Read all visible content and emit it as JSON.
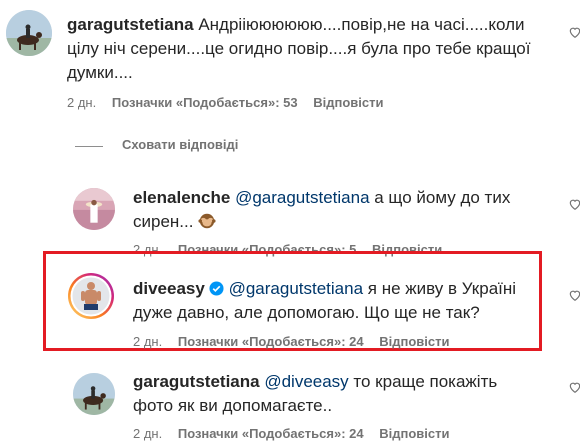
{
  "comments": [
    {
      "username": "garagutstetiana",
      "text": "Андрііюююююю....повір,не на часі.....коли цілу ніч серени....це огидно повір....я була про тебе кращої думки....",
      "time": "2 дн.",
      "likes": "Позначки «Подобається»: 53",
      "reply": "Відповісти",
      "avatar_icon": "horse-rider-avatar"
    },
    {
      "username": "elenalenche",
      "mention": "@garagutstetiana",
      "text": " а що йому до тих сирен...",
      "emoji": "see-no-evil-monkey",
      "time": "2 дн.",
      "likes": "Позначки «Подобається»: 5",
      "reply": "Відповісти",
      "avatar_icon": "pink-field-avatar"
    },
    {
      "username": "diveeasy",
      "verified": true,
      "mention": "@garagutstetiana",
      "text": " я не живу в Україні дуже давно, але допомогаю. Що ще не так?",
      "time": "2 дн.",
      "likes": "Позначки «Подобається»: 24",
      "reply": "Відповісти",
      "avatar_icon": "diver-avatar-with-story-ring"
    },
    {
      "username": "garagutstetiana",
      "mention": "@diveeasy",
      "text": " то краще покажіть фото як ви допомагаєте..",
      "time": "2 дн.",
      "likes": "Позначки «Подобається»: 24",
      "reply": "Відповісти",
      "avatar_icon": "horse-rider-avatar"
    }
  ],
  "hide_replies_label": "Сховати відповіді",
  "colors": {
    "highlight_border": "#e31b23",
    "mention": "#00376b",
    "meta": "#737373",
    "verified": "#0095f6"
  }
}
